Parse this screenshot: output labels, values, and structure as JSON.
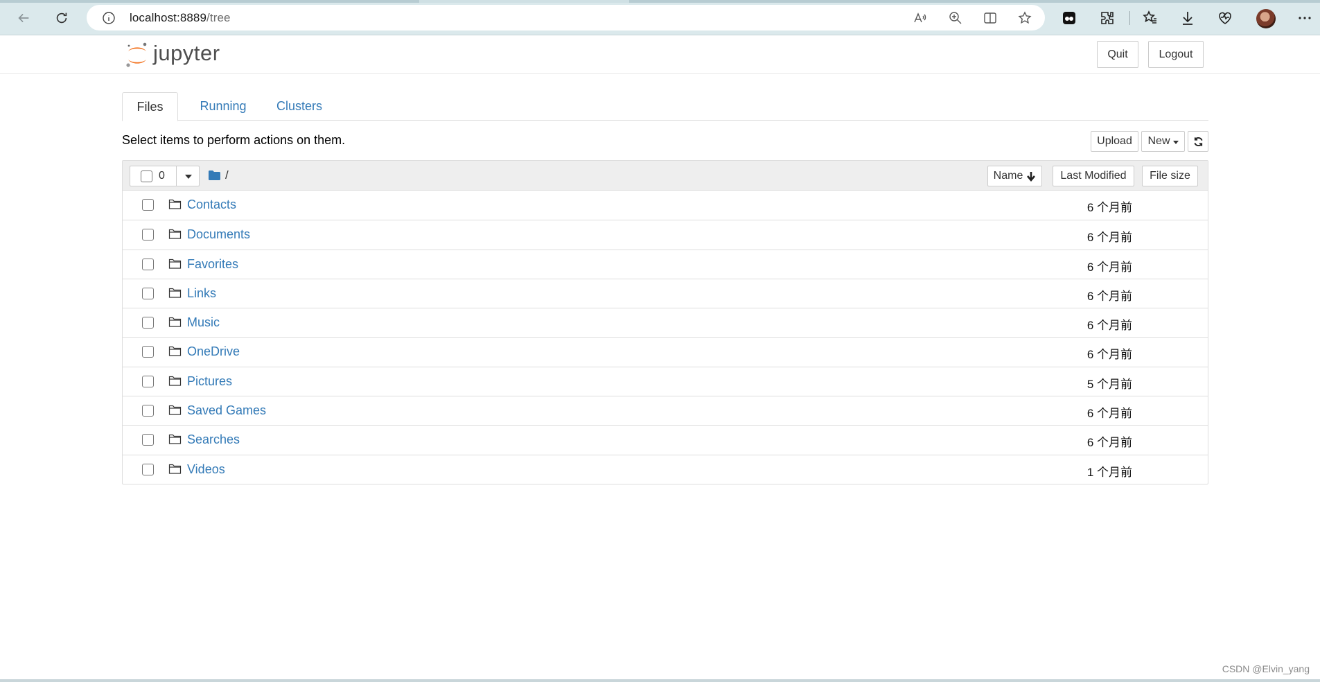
{
  "browser": {
    "url_host": "localhost:8889",
    "url_path": "/tree"
  },
  "header": {
    "logo_text": "jupyter",
    "quit_label": "Quit",
    "logout_label": "Logout"
  },
  "tabs": [
    {
      "label": "Files",
      "active": true
    },
    {
      "label": "Running",
      "active": false
    },
    {
      "label": "Clusters",
      "active": false
    }
  ],
  "toolbar": {
    "instructions": "Select items to perform actions on them.",
    "upload_label": "Upload",
    "new_label": "New"
  },
  "list_header": {
    "selected_count": "0",
    "breadcrumb": "/",
    "sort_name_label": "Name",
    "last_modified_label": "Last Modified",
    "file_size_label": "File size"
  },
  "files": [
    {
      "name": "Contacts",
      "modified": "6 个月前"
    },
    {
      "name": "Documents",
      "modified": "6 个月前"
    },
    {
      "name": "Favorites",
      "modified": "6 个月前"
    },
    {
      "name": "Links",
      "modified": "6 个月前"
    },
    {
      "name": "Music",
      "modified": "6 个月前"
    },
    {
      "name": "OneDrive",
      "modified": "6 个月前"
    },
    {
      "name": "Pictures",
      "modified": "5 个月前"
    },
    {
      "name": "Saved Games",
      "modified": "6 个月前"
    },
    {
      "name": "Searches",
      "modified": "6 个月前"
    },
    {
      "name": "Videos",
      "modified": "1 个月前"
    }
  ],
  "watermark": "CSDN @Elvin_yang",
  "colors": {
    "link": "#337ab7",
    "jupyter_orange": "#f37726",
    "chrome_bg": "#dbe9ec"
  }
}
